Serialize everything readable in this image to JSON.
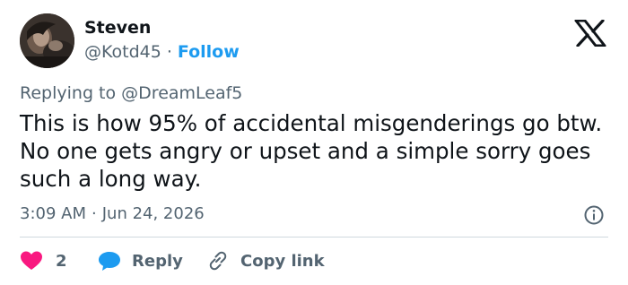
{
  "author": {
    "name": "Steven",
    "handle": "@Kotd45",
    "separator": "·",
    "follow_label": "Follow"
  },
  "reply": {
    "prefix": "Replying to",
    "mention": "@DreamLeaf5"
  },
  "tweet": {
    "text": "This is how 95% of accidental misgenderings go btw. No one gets angry or upset and a simple sorry goes such a long way."
  },
  "meta": {
    "time": "3:09 AM",
    "separator": "·",
    "date": "Jun 24, 2026"
  },
  "actions": {
    "like_count": "2",
    "reply_label": "Reply",
    "copy_label": "Copy link"
  },
  "colors": {
    "accent": "#1d9bf0",
    "like": "#f91880",
    "secondary_text": "#536471",
    "text": "#0f1419",
    "divider": "#cfd9de"
  },
  "icons": {
    "brand": "x-logo-icon",
    "like": "heart-icon",
    "reply": "speech-bubble-icon",
    "copy": "link-icon",
    "info": "info-icon"
  }
}
